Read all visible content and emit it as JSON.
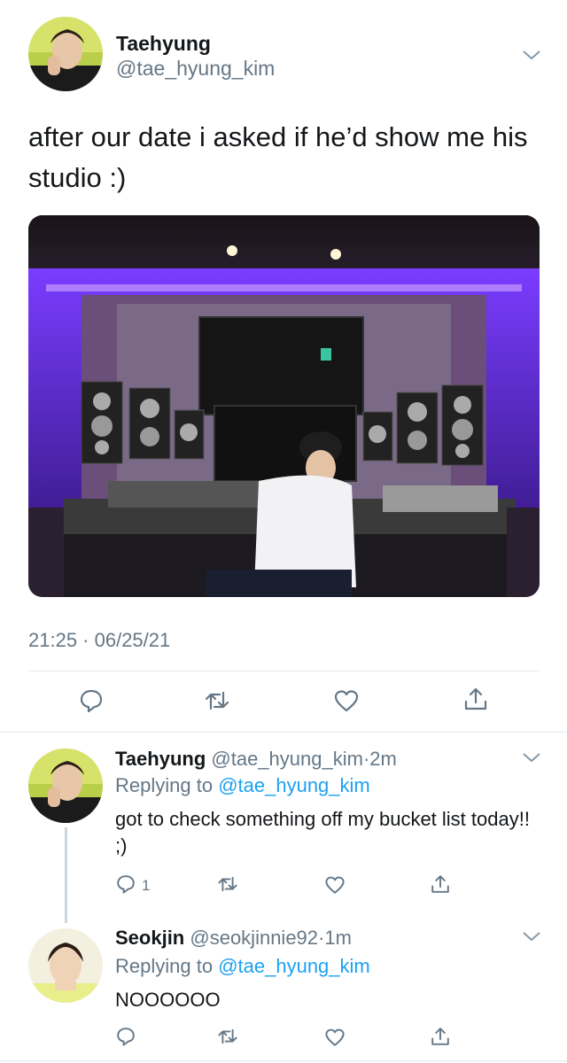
{
  "main_tweet": {
    "author_name": "Taehyung",
    "author_handle": "@tae_hyung_kim",
    "text": "after our date i asked if he’d show me his studio :)",
    "timestamp": "21:25 · 06/25/21",
    "photo_description_icon": "studio-photo",
    "actions": [
      "reply-icon",
      "retweet-icon",
      "like-icon",
      "share-icon"
    ]
  },
  "replies": [
    {
      "author_name": "Taehyung",
      "author_handle": "@tae_hyung_kim",
      "separator": "·",
      "time": "2m",
      "replying_prefix": "Replying to",
      "replying_to": "@tae_hyung_kim",
      "text": "got to check something off my bucket list today!! ;)",
      "reply_count": "1"
    },
    {
      "author_name": "Seokjin",
      "author_handle": "@seokjinnie92",
      "separator": "·",
      "time": "1m",
      "replying_prefix": "Replying to",
      "replying_to": "@tae_hyung_kim",
      "text": "NOOOOOO"
    }
  ],
  "colors": {
    "text": "#14171a",
    "secondary": "#657786",
    "link": "#1da1f2",
    "divider": "#e1e8ed",
    "studio_glow": "#6a2cff"
  }
}
